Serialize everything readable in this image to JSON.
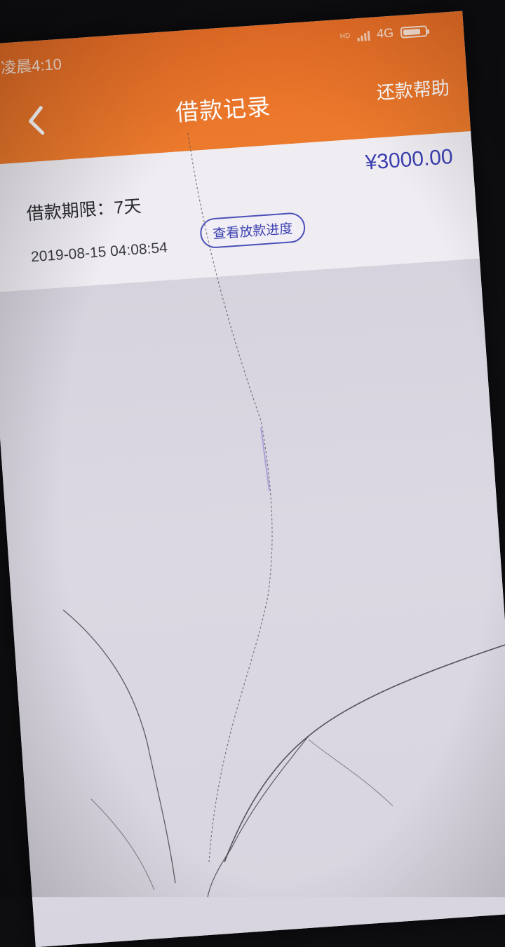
{
  "status_bar": {
    "time": "凌晨4:10",
    "hd": "HD",
    "network": "4G"
  },
  "header": {
    "back_icon": "chevron-left-icon",
    "title": "借款记录",
    "help_link": "还款帮助"
  },
  "record": {
    "term": "借款期限：7天",
    "amount": "¥3000.00",
    "date": "2019-08-15 04:08:54",
    "progress_button": "查看放款进度"
  },
  "colors": {
    "header": "#ea6f27",
    "accent": "#3b3fb0",
    "card": "#efedf2",
    "background": "#d8d5df"
  }
}
